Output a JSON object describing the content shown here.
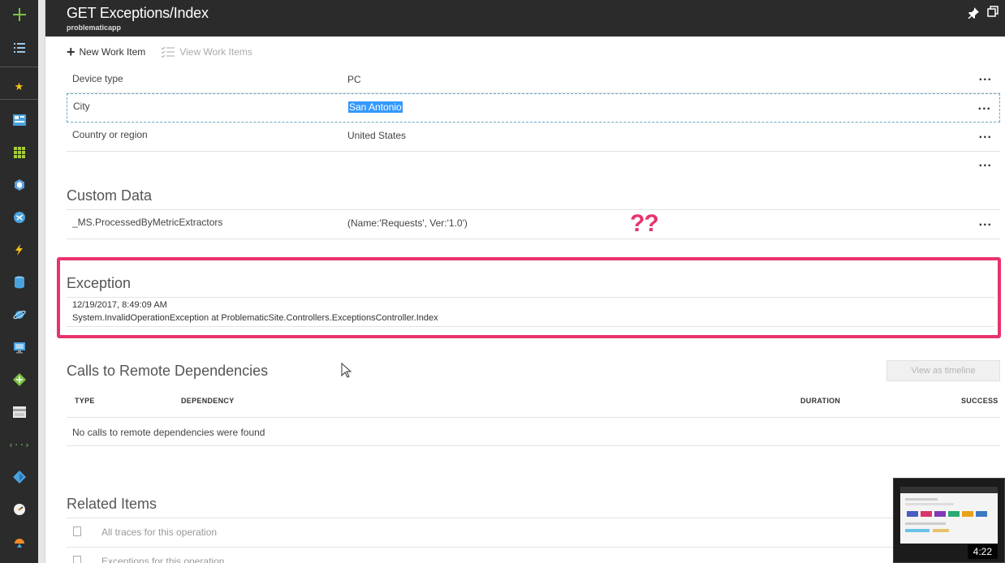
{
  "header": {
    "title": "GET Exceptions/Index",
    "subtitle": "problematicapp"
  },
  "toolbar": {
    "new_work_item": "New Work Item",
    "view_work_items": "View Work Items"
  },
  "properties": [
    {
      "key": "Device type",
      "value": "PC"
    },
    {
      "key": "City",
      "value": "San Antonio"
    },
    {
      "key": "Country or region",
      "value": "United States"
    }
  ],
  "custom_data": {
    "title": "Custom Data",
    "rows": [
      {
        "key": "_MS.ProcessedByMetricExtractors",
        "value": "(Name:'Requests', Ver:'1.0')"
      }
    ]
  },
  "annotation": "??",
  "exception": {
    "title": "Exception",
    "timestamp": "12/19/2017, 8:49:09 AM",
    "message": "System.InvalidOperationException at ProblematicSite.Controllers.ExceptionsController.Index"
  },
  "dependencies": {
    "title": "Calls to Remote Dependencies",
    "timeline_button": "View as timeline",
    "columns": [
      "TYPE",
      "DEPENDENCY",
      "DURATION",
      "SUCCESS"
    ],
    "empty_message": "No calls to remote dependencies were found"
  },
  "related": {
    "title": "Related Items",
    "items": [
      "All traces for this operation",
      "Exceptions for this operation"
    ]
  },
  "video": {
    "timestamp": "4:22"
  },
  "more_label": "..."
}
